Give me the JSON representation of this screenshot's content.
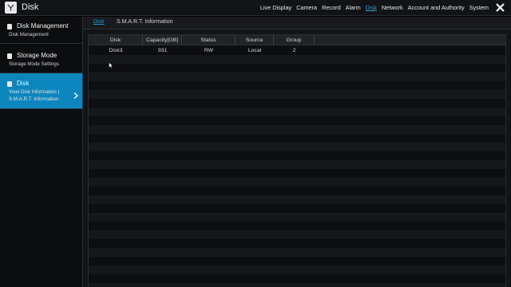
{
  "app": {
    "title": "Disk"
  },
  "nav": [
    {
      "label": "Live Display",
      "active": false
    },
    {
      "label": "Camera",
      "active": false
    },
    {
      "label": "Record",
      "active": false
    },
    {
      "label": "Alarm",
      "active": false
    },
    {
      "label": "Disk",
      "active": true
    },
    {
      "label": "Network",
      "active": false
    },
    {
      "label": "Account and Authority",
      "active": false
    },
    {
      "label": "System",
      "active": false
    }
  ],
  "sidebar": {
    "items": [
      {
        "title": "Disk Management",
        "subtitle": "Disk Management",
        "icon": "disk-management-icon",
        "active": false
      },
      {
        "title": "Storage Mode",
        "subtitle": "Storage Mode Settings",
        "icon": "storage-mode-icon",
        "active": false
      },
      {
        "title": "Disk",
        "subtitle": "View Disk Information | S.M.A.R.T. Information",
        "icon": "disk-icon",
        "active": true
      }
    ]
  },
  "tabs": [
    {
      "label": "Disk",
      "active": true
    },
    {
      "label": "S.M.A.R.T. Information",
      "active": false
    }
  ],
  "table": {
    "columns": [
      "Disk",
      "Capacity[GB]",
      "Status",
      "Source",
      "Group"
    ],
    "rows": [
      [
        "Disk3",
        "931",
        "RW",
        "Local",
        "2"
      ]
    ]
  },
  "colors": {
    "accent": "#0c86bc",
    "link": "#2aa4d8"
  }
}
